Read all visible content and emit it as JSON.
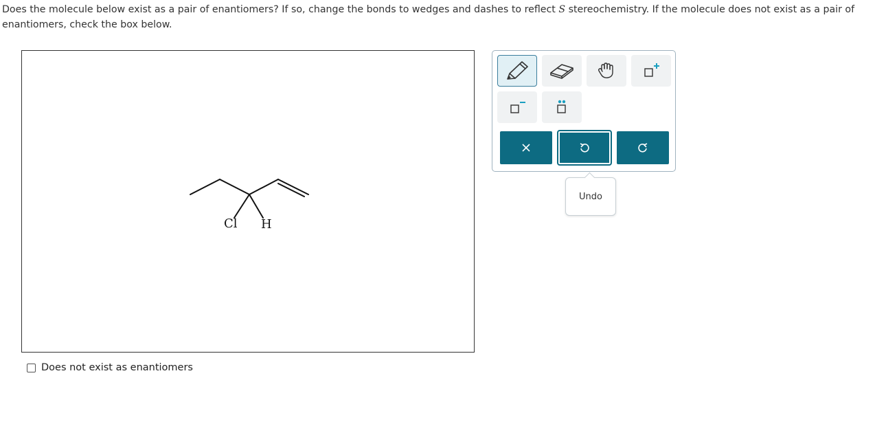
{
  "question": {
    "text_before": "Does the molecule below exist as a pair of enantiomers? If so, change the bonds to wedges and dashes to reflect ",
    "stereo_letter": "S",
    "text_after": " stereochemistry. If the molecule does not exist as a pair of enantiomers, check the box below."
  },
  "molecule": {
    "atoms": {
      "cl": "Cl",
      "h": "H"
    }
  },
  "toolbar": {
    "tools": [
      {
        "name": "pencil-tool",
        "icon": "pencil-icon",
        "selected": true
      },
      {
        "name": "eraser-tool",
        "icon": "eraser-icon",
        "selected": false
      },
      {
        "name": "hand-tool",
        "icon": "hand-icon",
        "selected": false
      },
      {
        "name": "positive-charge-tool",
        "icon": "plus-charge-icon",
        "selected": false
      },
      {
        "name": "negative-charge-tool",
        "icon": "minus-charge-icon",
        "selected": false
      },
      {
        "name": "lone-pair-tool",
        "icon": "lone-pair-icon",
        "selected": false
      }
    ],
    "actions": [
      {
        "name": "clear",
        "icon": "close-icon"
      },
      {
        "name": "undo",
        "icon": "undo-icon"
      },
      {
        "name": "redo",
        "icon": "redo-icon"
      }
    ],
    "accent_color": "#0d6b82",
    "charge_color": "#1a9fc0"
  },
  "tooltip": {
    "label": "Undo"
  },
  "checkbox": {
    "label": "Does not exist as enantiomers",
    "checked": false
  }
}
